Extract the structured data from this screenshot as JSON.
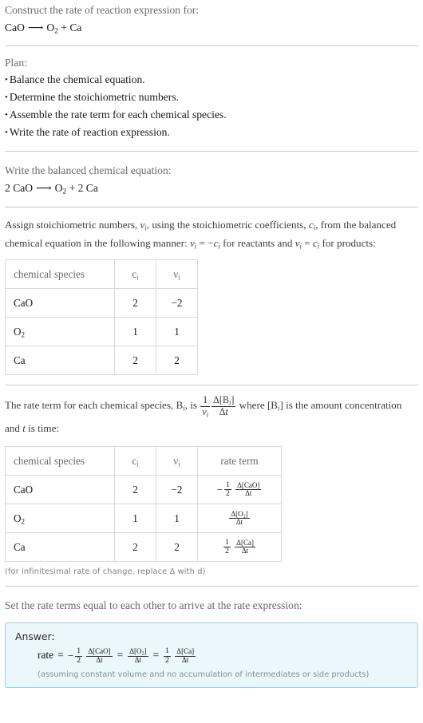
{
  "header": {
    "prompt": "Construct the rate of reaction expression for:",
    "equation": {
      "reactant": "CaO",
      "arrow": "⟶",
      "product_1": "O",
      "product_1_sub": "2",
      "plus": "+",
      "product_2": "Ca"
    }
  },
  "plan": {
    "label": "Plan:",
    "items": [
      "Balance the chemical equation.",
      "Determine the stoichiometric numbers.",
      "Assemble the rate term for each chemical species.",
      "Write the rate of reaction expression."
    ]
  },
  "balanced": {
    "label": "Write the balanced chemical equation:",
    "equation": {
      "reactant_coef": "2",
      "reactant": "CaO",
      "arrow": "⟶",
      "product_1": "O",
      "product_1_sub": "2",
      "plus": "+",
      "product_2_coef": "2",
      "product_2": "Ca"
    }
  },
  "stoichiometry": {
    "paragraph_1": "Assign stoichiometric numbers, ",
    "paragraph_2": ", using the stoichiometric coefficients, ",
    "paragraph_3": ", from the balanced chemical equation in the following manner: ",
    "paragraph_4": " = −",
    "paragraph_5": " for reactants and ",
    "paragraph_6": " = ",
    "paragraph_7": " for products:",
    "var_nu": "ν",
    "var_nu_sub": "i",
    "var_c": "c",
    "var_c_sub": "i",
    "table": {
      "headers": [
        "chemical species",
        "c",
        "ν"
      ],
      "header_subs": [
        "",
        "i",
        "i"
      ],
      "rows": [
        {
          "species": "CaO",
          "species_sub": "",
          "c": "2",
          "nu": "−2"
        },
        {
          "species": "O",
          "species_sub": "2",
          "c": "1",
          "nu": "1"
        },
        {
          "species": "Ca",
          "species_sub": "",
          "c": "2",
          "nu": "2"
        }
      ]
    }
  },
  "rate_terms": {
    "paragraph_1": "The rate term for each chemical species, ",
    "species_symbol": "B",
    "species_sub": "i",
    "paragraph_2": ", is ",
    "formula_num": "1",
    "formula_den_nu": "ν",
    "formula_den_sub": "i",
    "formula_delta_num": "Δ[B",
    "formula_delta_num_sub": "i",
    "formula_delta_num_end": "]",
    "formula_delta_den": "Δt",
    "paragraph_3": " where [B",
    "paragraph_3_sub": "i",
    "paragraph_4": "] is the amount concentration and ",
    "var_t": "t",
    "paragraph_5": " is time:",
    "table": {
      "headers": [
        "chemical species",
        "c",
        "ν",
        "rate term"
      ],
      "header_subs": [
        "",
        "i",
        "i",
        ""
      ],
      "rows": [
        {
          "species": "CaO",
          "species_sub": "",
          "c": "2",
          "nu": "−2",
          "rate_sign": "−",
          "rate_coef_num": "1",
          "rate_coef_den": "2",
          "rate_delta_num": "Δ[CaO]",
          "rate_delta_num_sub": "",
          "rate_delta_den": "Δt"
        },
        {
          "species": "O",
          "species_sub": "2",
          "c": "1",
          "nu": "1",
          "rate_sign": "",
          "rate_coef_num": "",
          "rate_coef_den": "",
          "rate_delta_num": "Δ[O",
          "rate_delta_num_sub": "2",
          "rate_delta_num_end": "]",
          "rate_delta_den": "Δt"
        },
        {
          "species": "Ca",
          "species_sub": "",
          "c": "2",
          "nu": "2",
          "rate_sign": "",
          "rate_coef_num": "1",
          "rate_coef_den": "2",
          "rate_delta_num": "Δ[Ca]",
          "rate_delta_num_sub": "",
          "rate_delta_den": "Δt"
        }
      ]
    },
    "footnote": "(for infinitesimal rate of change, replace Δ with d)"
  },
  "final": {
    "intro": "Set the rate terms equal to each other to arrive at the rate expression:",
    "answer_label": "Answer:",
    "rate_word": "rate",
    "equals": "=",
    "minus": "−",
    "term1": {
      "coef_num": "1",
      "coef_den": "2",
      "delta_num": "Δ[CaO]",
      "delta_den": "Δt"
    },
    "term2": {
      "delta_num": "Δ[O",
      "delta_num_sub": "2",
      "delta_num_end": "]",
      "delta_den": "Δt"
    },
    "term3": {
      "coef_num": "1",
      "coef_den": "2",
      "delta_num": "Δ[Ca]",
      "delta_den": "Δt"
    },
    "note": "(assuming constant volume and no accumulation of intermediates or side products)"
  },
  "colors": {
    "divider": "#c8c8c8",
    "muted_text": "#666a6d",
    "answer_bg": "#eaf7fb",
    "answer_border": "#9ecfe0"
  }
}
